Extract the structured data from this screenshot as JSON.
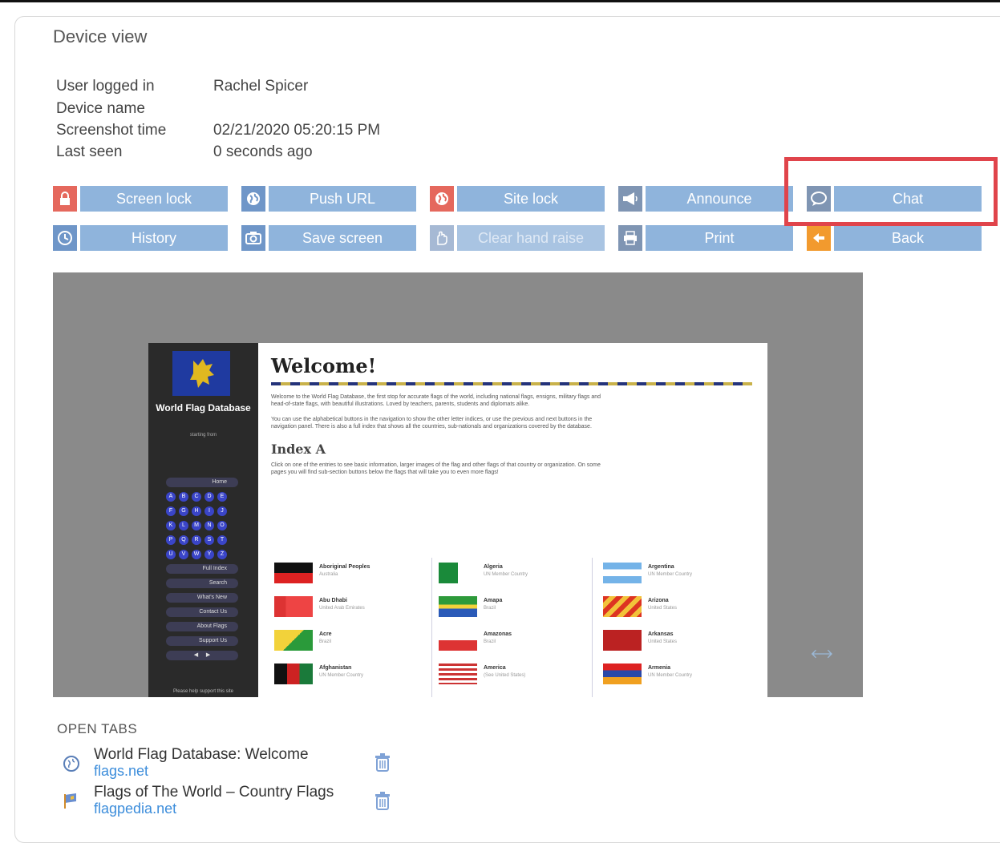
{
  "title": "Device view",
  "info": {
    "user_label": "User logged in",
    "user_value": "Rachel Spicer",
    "device_label": "Device name",
    "device_value": "",
    "screenshot_label": "Screenshot time",
    "screenshot_value": "02/21/2020 05:20:15 PM",
    "lastseen_label": "Last seen",
    "lastseen_value": "0 seconds ago"
  },
  "buttons": {
    "screen_lock": "Screen lock",
    "push_url": "Push URL",
    "site_lock": "Site lock",
    "announce": "Announce",
    "chat": "Chat",
    "history": "History",
    "save_screen": "Save screen",
    "clear_hand_raise": "Clear hand raise",
    "print": "Print",
    "back": "Back"
  },
  "preview": {
    "side_title": "World Flag Database",
    "side_sub": "starting from",
    "nav": [
      "Home",
      "Full Index",
      "Search",
      "What's New",
      "Contact Us",
      "About Flags",
      "Support Us"
    ],
    "letters": [
      "A",
      "B",
      "C",
      "D",
      "E",
      "F",
      "G",
      "H",
      "I",
      "J",
      "K",
      "L",
      "M",
      "N",
      "O",
      "P",
      "Q",
      "R",
      "S",
      "T",
      "U",
      "V",
      "W",
      "Y",
      "Z"
    ],
    "side_foot": "Please help support this site",
    "welcome": "Welcome!",
    "para1": "Welcome to the World Flag Database, the first stop for accurate flags of the world, including national flags, ensigns, military flags and head-of-state flags, with beautiful illustrations. Loved by teachers, parents, students and diplomats alike.",
    "para2": "You can use the alphabetical buttons in the navigation to show the other letter indices, or use the previous and next buttons in the navigation panel. There is also a full index that shows all the countries, sub-nationals and organizations covered by the database.",
    "index_title": "Index A",
    "para3": "Click on one of the entries to see basic information, larger images of the flag and other flags of that country or organization. On some pages you will find sub-section buttons below the flags that will take you to even more flags!",
    "flags": [
      {
        "name": "Aboriginal Peoples",
        "sub": "Australia"
      },
      {
        "name": "Algeria",
        "sub": "UN Member Country"
      },
      {
        "name": "Argentina",
        "sub": "UN Member Country"
      },
      {
        "name": "Abu Dhabi",
        "sub": "United Arab Emirates"
      },
      {
        "name": "Amapa",
        "sub": "Brazil"
      },
      {
        "name": "Arizona",
        "sub": "United States"
      },
      {
        "name": "Acre",
        "sub": "Brazil"
      },
      {
        "name": "Amazonas",
        "sub": "Brazil"
      },
      {
        "name": "Arkansas",
        "sub": "United States"
      },
      {
        "name": "Afghanistan",
        "sub": "UN Member Country"
      },
      {
        "name": "America",
        "sub": "(See United States)"
      },
      {
        "name": "Armenia",
        "sub": "UN Member Country"
      }
    ]
  },
  "open_tabs": {
    "heading": "OPEN TABS",
    "items": [
      {
        "title": "World Flag Database: Welcome",
        "url": "flags.net"
      },
      {
        "title": "Flags of The World – Country Flags",
        "url": "flagpedia.net"
      }
    ]
  }
}
